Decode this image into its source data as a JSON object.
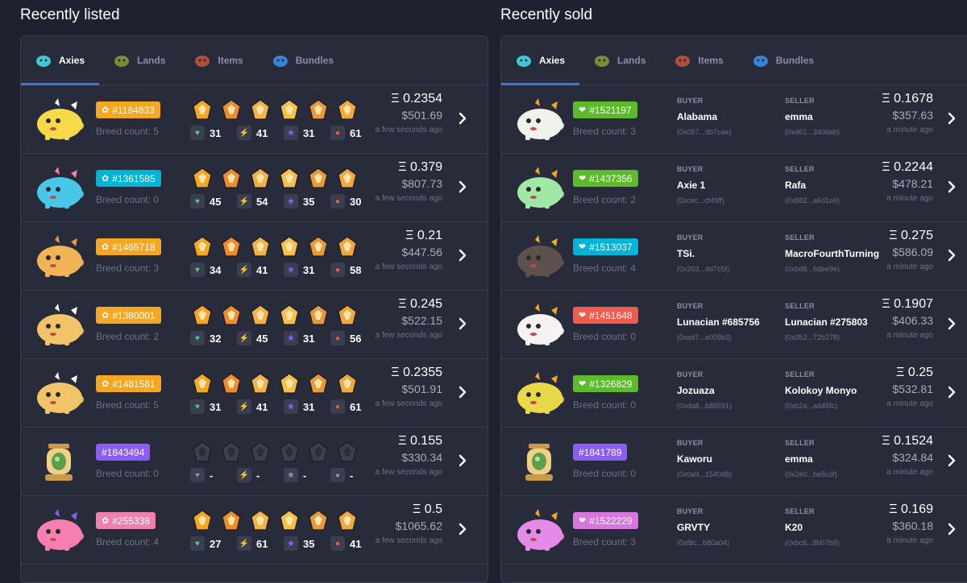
{
  "recently_listed": {
    "title": "Recently listed",
    "tabs": [
      {
        "label": "Axies",
        "icon": "axie-icon",
        "active": true
      },
      {
        "label": "Lands",
        "icon": "land-icon",
        "active": false
      },
      {
        "label": "Items",
        "icon": "item-icon",
        "active": false
      },
      {
        "label": "Bundles",
        "icon": "bundle-icon",
        "active": false
      }
    ],
    "rows": [
      {
        "id": "#1184833",
        "class_color": "#f5a623",
        "class": "beast",
        "breed": "Breed count: 5",
        "hp": "31",
        "speed": "41",
        "skill": "31",
        "morale": "61",
        "eth": "Ξ 0.2354",
        "usd": "$501.69",
        "ago": "a few seconds ago",
        "body": "#f7d94a",
        "ear": "#fff",
        "egg": false
      },
      {
        "id": "#1361585",
        "class_color": "#00b4d8",
        "class": "aquatic",
        "breed": "Breed count: 0",
        "hp": "45",
        "speed": "54",
        "skill": "35",
        "morale": "30",
        "eth": "Ξ 0.379",
        "usd": "$807.73",
        "ago": "a few seconds ago",
        "body": "#4ac6e8",
        "ear": "#ff7aa8",
        "egg": false
      },
      {
        "id": "#1465718",
        "class_color": "#f5a623",
        "class": "beast",
        "breed": "Breed count: 3",
        "hp": "34",
        "speed": "41",
        "skill": "31",
        "morale": "58",
        "eth": "Ξ 0.21",
        "usd": "$447.56",
        "ago": "a few seconds ago",
        "body": "#f0b456",
        "ear": "#e89a3a",
        "egg": false
      },
      {
        "id": "#1380001",
        "class_color": "#f5a623",
        "class": "beast",
        "breed": "Breed count: 2",
        "hp": "32",
        "speed": "45",
        "skill": "31",
        "morale": "56",
        "eth": "Ξ 0.245",
        "usd": "$522.15",
        "ago": "a few seconds ago",
        "body": "#f2c46a",
        "ear": "#fff",
        "egg": false
      },
      {
        "id": "#1481581",
        "class_color": "#f5a623",
        "class": "beast",
        "breed": "Breed count: 5",
        "hp": "31",
        "speed": "41",
        "skill": "31",
        "morale": "61",
        "eth": "Ξ 0.2355",
        "usd": "$501.91",
        "ago": "a few seconds ago",
        "body": "#f2c46a",
        "ear": "#fff",
        "egg": false
      },
      {
        "id": "#1843494",
        "class_color": "#8b5cf6",
        "class": "",
        "breed": "Breed count: 0",
        "hp": "-",
        "speed": "-",
        "skill": "-",
        "morale": "-",
        "eth": "Ξ 0.155",
        "usd": "$330.34",
        "ago": "a few seconds ago",
        "body": "#e8b96a",
        "ear": "#4a8f3a",
        "egg": true
      },
      {
        "id": "#255338",
        "class_color": "#f080b0",
        "class": "reptile",
        "breed": "Breed count: 4",
        "hp": "27",
        "speed": "61",
        "skill": "35",
        "morale": "41",
        "eth": "Ξ 0.5",
        "usd": "$1065.62",
        "ago": "a few seconds ago",
        "body": "#f57fb0",
        "ear": "#8b5cf6",
        "egg": false
      }
    ]
  },
  "recently_sold": {
    "title": "Recently sold",
    "tabs": [
      {
        "label": "Axies",
        "icon": "axie-icon",
        "active": true
      },
      {
        "label": "Lands",
        "icon": "land-icon",
        "active": false
      },
      {
        "label": "Items",
        "icon": "item-icon",
        "active": false
      },
      {
        "label": "Bundles",
        "icon": "bundle-icon",
        "active": false
      }
    ],
    "buyer_label": "BUYER",
    "seller_label": "SELLER",
    "rows": [
      {
        "id": "#1521197",
        "class_color": "#5cbb2b",
        "breed": "Breed count: 3",
        "buyer": "Alabama",
        "buyer_addr": "(0x057...db7cae)",
        "seller": "emma",
        "seller_addr": "(0xd61...340dab)",
        "eth": "Ξ 0.1678",
        "usd": "$357.63",
        "ago": "a minute ago",
        "body": "#eef2ea"
      },
      {
        "id": "#1437356",
        "class_color": "#5cbb2b",
        "breed": "Breed count: 2",
        "buyer": "Axie 1",
        "buyer_addr": "(0xcec...cf49ff)",
        "seller": "Rafa",
        "seller_addr": "(0x882...a6d1e6)",
        "eth": "Ξ 0.2244",
        "usd": "$478.21",
        "ago": "a minute ago",
        "body": "#9fe8a6"
      },
      {
        "id": "#1513037",
        "class_color": "#00b4d8",
        "breed": "Breed count: 4",
        "buyer": "TSi.",
        "buyer_addr": "(0x203...dd7c5f)",
        "seller": "MacroFourthTurning",
        "seller_addr": "(0xbd8...6dee9e)",
        "eth": "Ξ 0.275",
        "usd": "$586.09",
        "ago": "a minute ago",
        "body": "#5c514d"
      },
      {
        "id": "#1451648",
        "class_color": "#f25a4b",
        "breed": "Breed count: 0",
        "buyer": "Lunacian #685756",
        "buyer_addr": "(0xed7...e009b3)",
        "seller": "Lunacian #275803",
        "seller_addr": "(0x052...72b278)",
        "eth": "Ξ 0.1907",
        "usd": "$406.33",
        "ago": "a minute ago",
        "body": "#f7f2f2"
      },
      {
        "id": "#1326829",
        "class_color": "#5cbb2b",
        "breed": "Breed count: 0",
        "buyer": "Jozuaza",
        "buyer_addr": "(0xda8...b88591)",
        "seller": "Kolokoy Monyo",
        "seller_addr": "(0xb2a...ad45fc)",
        "eth": "Ξ 0.25",
        "usd": "$532.81",
        "ago": "a minute ago",
        "body": "#e8d84a"
      },
      {
        "id": "#1841789",
        "class_color": "#8b5cf6",
        "breed": "Breed count: 0",
        "buyer": "Kaworu",
        "buyer_addr": "(0x0a9...1540d8)",
        "seller": "emma",
        "seller_addr": "(0x2e0...be5cdf)",
        "eth": "Ξ 0.1524",
        "usd": "$324.84",
        "ago": "a minute ago",
        "body": "#e8b96a",
        "egg": true
      },
      {
        "id": "#1522229",
        "class_color": "#d876e0",
        "breed": "Breed count: 3",
        "buyer": "GRVTY",
        "buyer_addr": "(0xf8c...b80a04)",
        "seller": "K20",
        "seller_addr": "(0xbc6...9b07b9)",
        "eth": "Ξ 0.169",
        "usd": "$360.18",
        "ago": "a minute ago",
        "body": "#e48ae8"
      }
    ]
  }
}
